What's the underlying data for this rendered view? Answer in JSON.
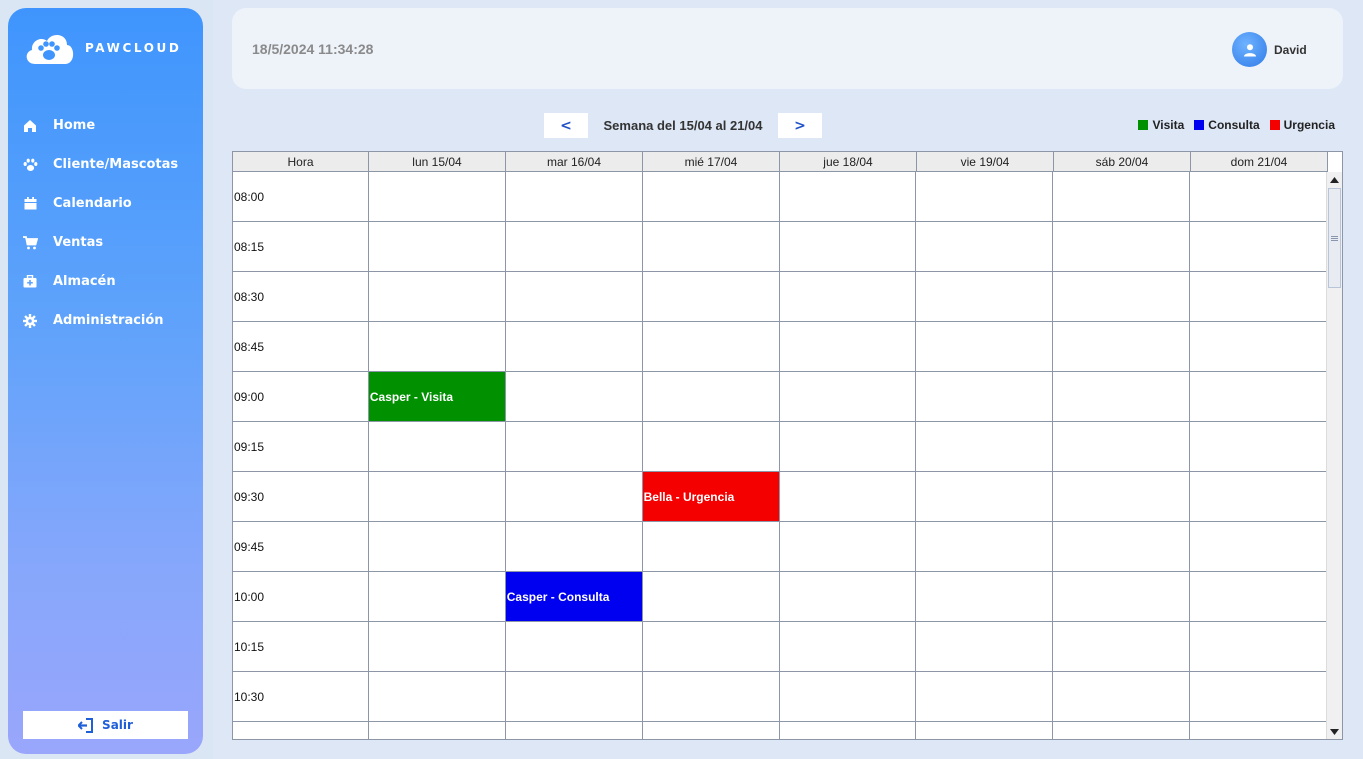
{
  "brand": {
    "name": "PAWCLOUD",
    "icon": "paw-cloud-icon"
  },
  "sidebar": {
    "items": [
      {
        "label": "Home",
        "icon": "home-icon"
      },
      {
        "label": "Cliente/Mascotas",
        "icon": "paw-icon"
      },
      {
        "label": "Calendario",
        "icon": "calendar-icon"
      },
      {
        "label": "Ventas",
        "icon": "cart-icon"
      },
      {
        "label": "Almacén",
        "icon": "medkit-icon"
      },
      {
        "label": "Administración",
        "icon": "gear-icon"
      }
    ],
    "logout_label": "Salir"
  },
  "header": {
    "datetime": "18/5/2024 11:34:28",
    "user_name": "David"
  },
  "week_nav": {
    "prev_label": "<",
    "next_label": ">",
    "week_label": "Semana del 15/04 al 21/04"
  },
  "legend": [
    {
      "label": "Visita",
      "color": "#009000"
    },
    {
      "label": "Consulta",
      "color": "#0000f0"
    },
    {
      "label": "Urgencia",
      "color": "#f40000"
    }
  ],
  "calendar": {
    "columns": [
      "Hora",
      "lun 15/04",
      "mar 16/04",
      "mié 17/04",
      "jue 18/04",
      "vie 19/04",
      "sáb 20/04",
      "dom 21/04"
    ],
    "rows": [
      {
        "time": "08:00",
        "cells": [
          "",
          "",
          "",
          "",
          "",
          "",
          ""
        ]
      },
      {
        "time": "08:15",
        "cells": [
          "",
          "",
          "",
          "",
          "",
          "",
          ""
        ]
      },
      {
        "time": "08:30",
        "cells": [
          "",
          "",
          "",
          "",
          "",
          "",
          ""
        ]
      },
      {
        "time": "08:45",
        "cells": [
          "",
          "",
          "",
          "",
          "",
          "",
          ""
        ]
      },
      {
        "time": "09:00",
        "cells": [
          "Casper - Visita",
          "",
          "",
          "",
          "",
          "",
          ""
        ]
      },
      {
        "time": "09:15",
        "cells": [
          "",
          "",
          "",
          "",
          "",
          "",
          ""
        ]
      },
      {
        "time": "09:30",
        "cells": [
          "",
          "",
          "Bella - Urgencia",
          "",
          "",
          "",
          ""
        ]
      },
      {
        "time": "09:45",
        "cells": [
          "",
          "",
          "",
          "",
          "",
          "",
          ""
        ]
      },
      {
        "time": "10:00",
        "cells": [
          "",
          "Casper - Consulta",
          "",
          "",
          "",
          "",
          ""
        ]
      },
      {
        "time": "10:15",
        "cells": [
          "",
          "",
          "",
          "",
          "",
          "",
          ""
        ]
      },
      {
        "time": "10:30",
        "cells": [
          "",
          "",
          "",
          "",
          "",
          "",
          ""
        ]
      },
      {
        "time": "",
        "cells": [
          "",
          "",
          "",
          "",
          "",
          "",
          ""
        ]
      }
    ],
    "events": [
      {
        "row": 4,
        "day": 0,
        "type": "Visita",
        "color": "#009000"
      },
      {
        "row": 6,
        "day": 2,
        "type": "Urgencia",
        "color": "#f40000"
      },
      {
        "row": 8,
        "day": 1,
        "type": "Consulta",
        "color": "#0000f0"
      }
    ]
  }
}
